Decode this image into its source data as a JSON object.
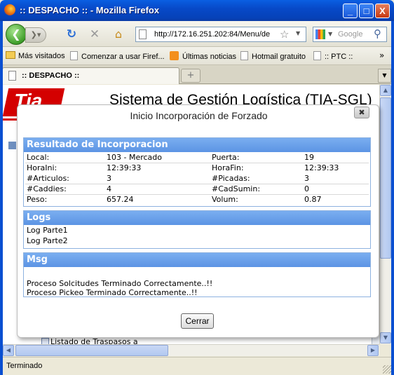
{
  "window": {
    "title": ":: DESPACHO :: - Mozilla Firefox",
    "min_label": "_",
    "max_label": "□",
    "close_label": "X"
  },
  "nav": {
    "url": "http://172.16.251.202:84/Menu/de",
    "search_placeholder": "Google",
    "back_glyph": "❮",
    "forward_glyph": "❯▾",
    "reload_glyph": "↻",
    "stop_glyph": "✕",
    "home_glyph": "⌂",
    "star_glyph": "☆",
    "drop_glyph": "▼",
    "search_glyph": "⚲"
  },
  "bookmarks": {
    "items": [
      "Más visitados",
      "Comenzar a usar Firef...",
      "Últimas noticias",
      "Hotmail gratuito",
      ":: PTC ::"
    ],
    "more": "»"
  },
  "tabs": {
    "active_label": ":: DESPACHO ::",
    "new_tab_glyph": "+",
    "list_glyph": "▼"
  },
  "page": {
    "logo_text": "Tia",
    "system_title": "Sistema de Gestión Logística (TIA-SGL)",
    "bg_list_item": "Listado de Traspasos a"
  },
  "dialog": {
    "title": "Inicio Incorporación de Forzado",
    "close_glyph": "✖",
    "result": {
      "header": "Resultado de Incorporacion",
      "rows": [
        {
          "label1": "Local:",
          "value1": "103 - Mercado",
          "label2": "Puerta:",
          "value2": "19"
        },
        {
          "label1": "HoraIni:",
          "value1": "12:39:33",
          "label2": "HoraFin:",
          "value2": "12:39:33"
        },
        {
          "label1": "#Articulos:",
          "value1": "3",
          "label2": "#Picadas:",
          "value2": "3"
        },
        {
          "label1": "#Caddies:",
          "value1": "4",
          "label2": "#CadSumin:",
          "value2": "0"
        },
        {
          "label1": "Peso:",
          "value1": "657.24",
          "label2": "Volum:",
          "value2": "0.87"
        }
      ]
    },
    "logs": {
      "header": "Logs",
      "lines": [
        "Log Parte1",
        "Log Parte2"
      ]
    },
    "msg": {
      "header": "Msg",
      "lines": [
        "",
        "Proceso Solcitudes Terminado Correctamente..!!",
        "Proceso Pickeo Terminado Correctamente..!!"
      ]
    },
    "close_button": "Cerrar"
  },
  "status": {
    "text": "Terminado"
  },
  "colors": {
    "titlebar": "#0749c8",
    "panel_header": "#6aa0ea",
    "brand_red": "#d40000"
  }
}
